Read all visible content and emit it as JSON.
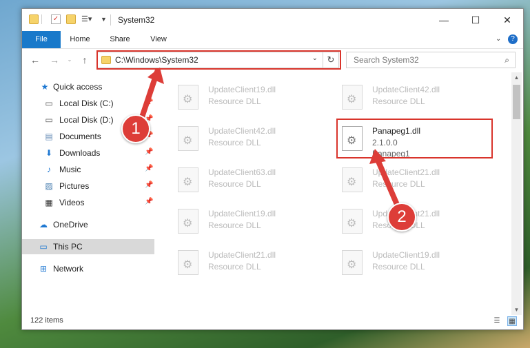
{
  "window": {
    "title": "System32",
    "controls": {
      "minimize": "—",
      "maximize": "☐",
      "close": "✕"
    }
  },
  "ribbon": {
    "tabs": [
      "File",
      "Home",
      "Share",
      "View"
    ],
    "help": "?"
  },
  "navbar": {
    "address": "C:\\Windows\\System32",
    "search_placeholder": "Search System32"
  },
  "sidebar": {
    "items": [
      {
        "label": "Quick access",
        "icon": "star-icon"
      },
      {
        "label": "Local Disk (C:)",
        "icon": "drive-icon"
      },
      {
        "label": "Local Disk (D:)",
        "icon": "drive-icon"
      },
      {
        "label": "Documents",
        "icon": "documents-icon"
      },
      {
        "label": "Downloads",
        "icon": "downloads-icon"
      },
      {
        "label": "Music",
        "icon": "music-icon"
      },
      {
        "label": "Pictures",
        "icon": "pictures-icon"
      },
      {
        "label": "Videos",
        "icon": "videos-icon"
      },
      {
        "label": "OneDrive",
        "icon": "cloud-icon"
      },
      {
        "label": "This PC",
        "icon": "computer-icon"
      },
      {
        "label": "Network",
        "icon": "network-icon"
      }
    ]
  },
  "files": {
    "left": [
      {
        "name": "UpdateClient19.dll",
        "type": "Resource DLL"
      },
      {
        "name": "UpdateClient42.dll",
        "type": "Resource DLL"
      },
      {
        "name": "UpdateClient63.dll",
        "type": "Resource DLL"
      },
      {
        "name": "UpdateClient19.dll",
        "type": "Resource DLL"
      },
      {
        "name": "UpdateClient21.dll",
        "type": "Resource DLL"
      }
    ],
    "right": [
      {
        "name": "UpdateClient42.dll",
        "type": "Resource DLL"
      },
      {
        "name": "UpdateClient21.dll",
        "type": "Resource DLL"
      },
      {
        "name": "UpdateClient21.dll",
        "type": "Resource DLL"
      },
      {
        "name": "UpdateClient19.dll",
        "type": "Resource DLL"
      }
    ],
    "highlighted": {
      "name": "Panapeg1.dll",
      "version": "2.1.0.0",
      "description": "Panapeg1"
    }
  },
  "annotations": {
    "step1": "1",
    "step2": "2",
    "color": "#dd3d38"
  },
  "status": {
    "count": "122 items"
  }
}
